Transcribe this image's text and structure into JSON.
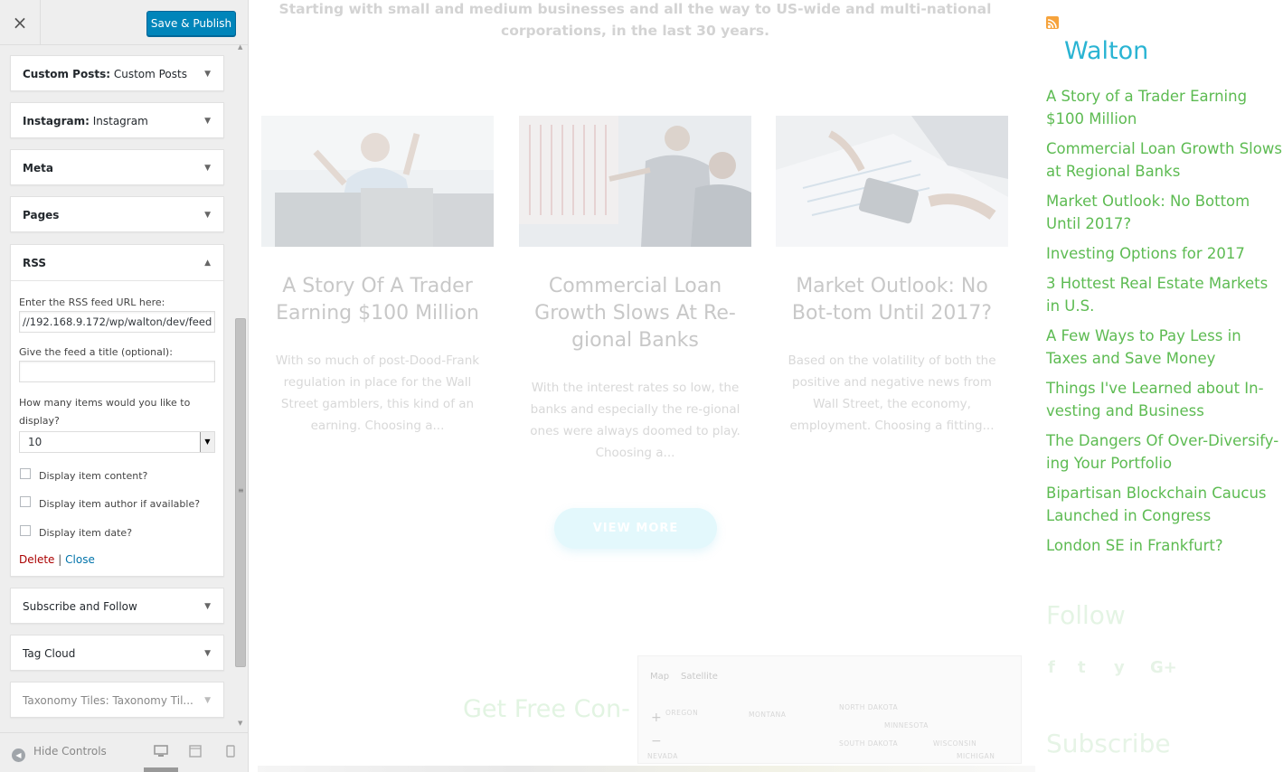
{
  "customizer": {
    "close_glyph": "×",
    "publish_label": "Save & Publish",
    "panels": [
      {
        "name": "Custom Posts:",
        "sub": " Custom Posts"
      },
      {
        "name": "Instagram:",
        "sub": " Instagram"
      },
      {
        "name": "Meta",
        "sub": ""
      },
      {
        "name": "Pages",
        "sub": ""
      }
    ],
    "rss": {
      "title": "RSS",
      "url_label": "Enter the RSS feed URL here:",
      "url_value": "//192.168.9.172/wp/walton/dev/feed",
      "title_label": "Give the feed a title (optional):",
      "title_value": "",
      "items_label": "How many items would you like to display?",
      "items_value": "10",
      "cb_content": "Display item content?",
      "cb_author": "Display item author if available?",
      "cb_date": "Display item date?",
      "delete_label": "Delete",
      "separator": "|",
      "close_label": "Close"
    },
    "panels_after": [
      {
        "name": "Subscribe and Follow",
        "sub": ""
      },
      {
        "name": "Tag Cloud",
        "sub": ""
      },
      {
        "name": "Taxonomy Tiles:",
        "sub": " Taxonomy Til..."
      }
    ],
    "footer": {
      "hide_controls": "Hide Controls"
    },
    "icons": {
      "close": "close-icon",
      "expand": "triangle-down-icon",
      "collapse": "triangle-up-icon",
      "hide_controls": "arrow-left-circle-icon",
      "desktop": "desktop-icon",
      "tablet": "tablet-icon",
      "mobile": "mobile-icon"
    }
  },
  "preview": {
    "intro": "Starting with small and medium businesses and all the way to US-wide and multi-national corporations, in the last 30 years.",
    "posts": [
      {
        "title": "A Story Of A Trader Earning $100 Million",
        "excerpt": "With so much of post-Dood-Frank regulation in place for the Wall Street gamblers, this kind of an earning. Choosing a..."
      },
      {
        "title": "Commercial Loan Growth Slows At Re-gional Banks",
        "excerpt": "With the interest rates so low, the banks and especially the re-gional ones were always doomed to play. Choosing a..."
      },
      {
        "title": "Market Outlook: No Bot-tom Until 2017?",
        "excerpt": "Based on the volatility of both the positive and negative news from Wall Street, the economy, employment. Choosing a fitting..."
      }
    ],
    "view_more": "VIEW MORE",
    "contact_title": "Get Free Con-",
    "map": {
      "tab_map": "Map",
      "tab_satellite": "Satellite",
      "zoom_in": "+",
      "zoom_out": "−",
      "labels": [
        "OREGON",
        "MONTANA",
        "NORTH DAKOTA",
        "MINNESOTA",
        "SOUTH DAKOTA",
        "WISCONSIN",
        "NEVADA",
        "MICHIGAN"
      ]
    },
    "widget": {
      "title": "Walton",
      "items": [
        "A Story of a Trader Earning $100 Million",
        "Commercial Loan Growth Slows at Regional Banks",
        "Market Outlook: No Bottom Until 2017?",
        "Investing Options for 2017",
        "3 Hottest Real Estate Markets in U.S.",
        "A Few Ways to Pay Less in Taxes and Save Money",
        "Things I've Learned about In-vesting and Business",
        "The Dangers Of Over-Diversify-ing Your Portfolio",
        "Bipartisan Blockchain Caucus Launched in Congress",
        "London SE in Frankfurt?"
      ],
      "follow_title": "Follow",
      "social": [
        "f",
        "t",
        "y",
        "G+"
      ],
      "subscribe_title": "Subscribe"
    },
    "colors": {
      "accent_blue": "#2ab4d3",
      "link_green": "#5dbb52",
      "publish_blue": "#0085ba",
      "delete_red": "#aa0000"
    }
  }
}
